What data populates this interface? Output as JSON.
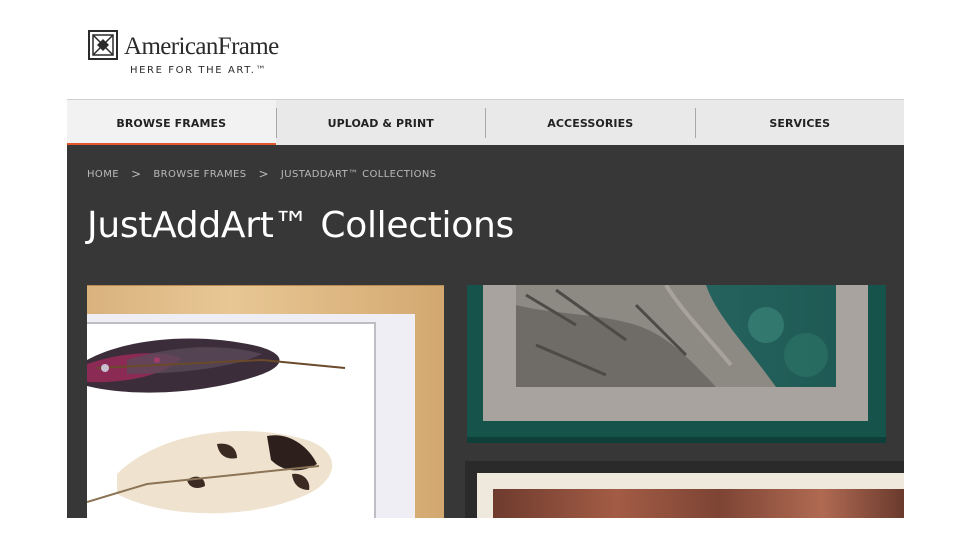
{
  "brand": {
    "name": "AmericanFrame",
    "tagline": "HERE FOR THE ART.™"
  },
  "nav": {
    "items": [
      {
        "label": "BROWSE FRAMES",
        "active": true
      },
      {
        "label": "UPLOAD & PRINT",
        "active": false
      },
      {
        "label": "ACCESSORIES",
        "active": false
      },
      {
        "label": "SERVICES",
        "active": false
      }
    ]
  },
  "breadcrumb": {
    "items": [
      "HOME",
      "BROWSE FRAMES",
      "JUSTADDART™ COLLECTIONS"
    ],
    "separator": ">"
  },
  "page": {
    "title": "JustAddArt™ Collections"
  },
  "colors": {
    "accent": "#e2572c",
    "hero_bg": "#373737",
    "nav_bg": "#e9e9e9"
  }
}
